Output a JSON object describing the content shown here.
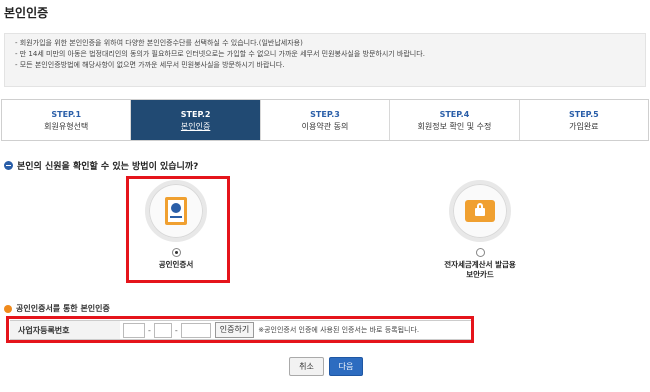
{
  "page": {
    "title": "본인인증"
  },
  "notice": {
    "items": [
      "회원가입을 위한 본인인증을 위하여 다양한 본인인증수단를 선택하실 수 있습니다.(일반납세자용)",
      "만 14세 미만의 아동은 법정대리인의 동의가 필요하므로 인터넷으로는 가입할 수 없으니 가까운 세무서 민원봉사실을 방문하시기 바랍니다.",
      "모든 본인인증방법에 해당사항이 없으면 가까운 세무서 민원봉사실을 방문하시기 바랍니다."
    ]
  },
  "steps": [
    {
      "num": "STEP.1",
      "label": "회원유형선택"
    },
    {
      "num": "STEP.2",
      "label": "본인인증"
    },
    {
      "num": "STEP.3",
      "label": "이용약관 동의"
    },
    {
      "num": "STEP.4",
      "label": "회원정보 확인 및 수정"
    },
    {
      "num": "STEP.5",
      "label": "가입완료"
    }
  ],
  "active_step": 2,
  "question": "본인의 신원을 확인할 수 있는 방법이 있습니까?",
  "methods": {
    "certificate": {
      "label": "공인인증서",
      "checked": true
    },
    "card": {
      "line1": "전자세금계산서 발급용",
      "line2": "보안카드",
      "checked": false
    }
  },
  "cert_section": {
    "title": "공인인증서를 통한 본인인증",
    "field_label": "사업자등록번호",
    "dash": "-",
    "button": "인증하기",
    "hint": "※공인인증서 인증에 사용된 인증서는 바로 등록됩니다."
  },
  "buttons": {
    "cancel": "취소",
    "next": "다음"
  },
  "colors": {
    "active_step_bg": "#214a73",
    "step_num": "#2a5ea8",
    "highlight": "#e5141b",
    "next_button": "#2d6cc0",
    "accent_orange": "#f08a1c"
  }
}
